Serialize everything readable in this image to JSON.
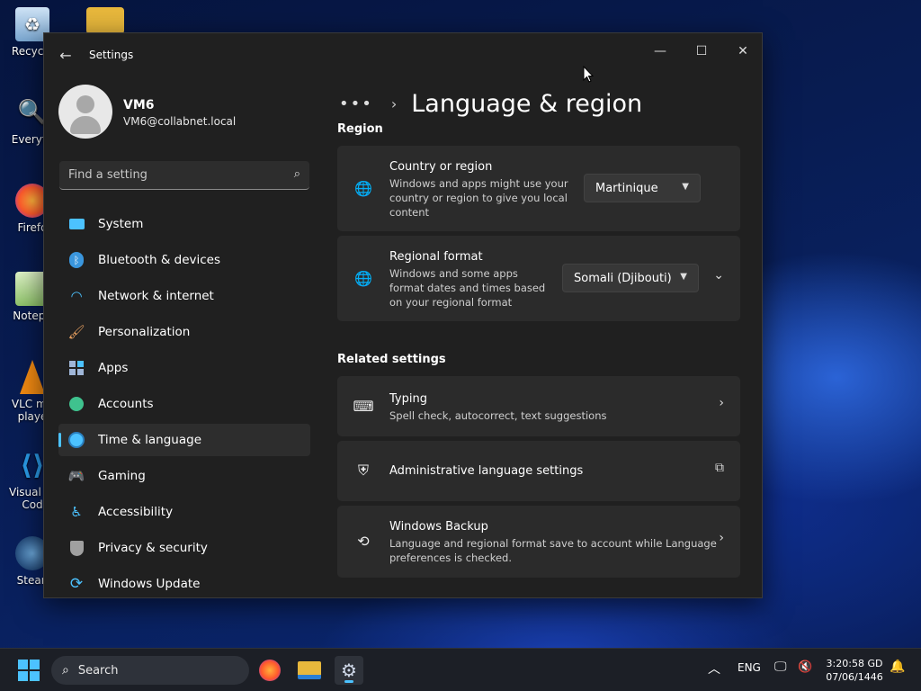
{
  "desktop": {
    "icons": [
      {
        "label": "Recycle",
        "icon": "recycle-bin-icon"
      },
      {
        "label": "Everyth",
        "icon": "everything-search-icon"
      },
      {
        "label": "Firefo",
        "icon": "firefox-icon"
      },
      {
        "label": "Notepa",
        "icon": "notepad-icon"
      },
      {
        "label": "VLC me",
        "label2": "playe",
        "icon": "vlc-icon"
      },
      {
        "label": "Visual St",
        "label2": "Cod",
        "icon": "vscode-icon"
      },
      {
        "label": "Stean",
        "icon": "steam-icon"
      }
    ]
  },
  "window": {
    "title": "Settings",
    "controls": {
      "minimize": "—",
      "maximize": "☐",
      "close": "✕"
    }
  },
  "profile": {
    "name": "VM6",
    "email": "VM6@collabnet.local"
  },
  "search": {
    "placeholder": "Find a setting"
  },
  "nav": {
    "items": [
      {
        "label": "System",
        "icon": "system-icon",
        "color": "#4cc2ff"
      },
      {
        "label": "Bluetooth & devices",
        "icon": "bluetooth-icon",
        "color": "#3a96dd"
      },
      {
        "label": "Network & internet",
        "icon": "wifi-icon",
        "color": "#4cc2ff"
      },
      {
        "label": "Personalization",
        "icon": "brush-icon",
        "color": "#e8a060"
      },
      {
        "label": "Apps",
        "icon": "apps-icon",
        "color": "#9fb6d8"
      },
      {
        "label": "Accounts",
        "icon": "accounts-icon",
        "color": "#3fc28e"
      },
      {
        "label": "Time & language",
        "icon": "globe-clock-icon",
        "color": "#4cc2ff"
      },
      {
        "label": "Gaming",
        "icon": "gamepad-icon",
        "color": "#b4b4b4"
      },
      {
        "label": "Accessibility",
        "icon": "accessibility-icon",
        "color": "#4cc2ff"
      },
      {
        "label": "Privacy & security",
        "icon": "shield-icon",
        "color": "#a0a0a0"
      },
      {
        "label": "Windows Update",
        "icon": "update-icon",
        "color": "#4cc2ff"
      }
    ],
    "selected": "Time & language"
  },
  "content": {
    "breadcrumb_more": "•••",
    "page_title": "Language & region",
    "region_heading": "Region",
    "country": {
      "title": "Country or region",
      "desc1": "Windows and apps might use your",
      "desc2": "country or region to give you local",
      "desc3": "content",
      "value": "Martinique"
    },
    "format": {
      "title": "Regional format",
      "desc1": "Windows and some apps",
      "desc2": "format dates and times based",
      "desc3": "on your regional format",
      "value": "Somali (Djibouti)"
    },
    "related_heading": "Related settings",
    "typing": {
      "title": "Typing",
      "desc": "Spell check, autocorrect, text suggestions"
    },
    "admin": {
      "title": "Administrative language settings"
    },
    "backup": {
      "title": "Windows Backup",
      "desc1": "Language and regional format save to account while Language",
      "desc2": "preferences is checked."
    }
  },
  "taskbar": {
    "search_label": "Search",
    "language": "ENG",
    "time": "3:20:58 GD",
    "date": "07/06/1446"
  }
}
